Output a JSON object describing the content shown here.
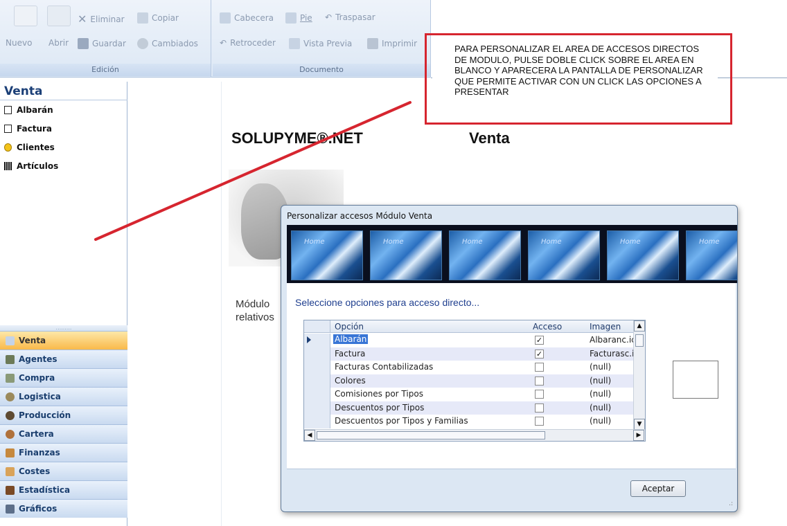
{
  "ribbon": {
    "edicion": {
      "label": "Edición",
      "nuevo": "Nuevo",
      "abrir": "Abrir",
      "eliminar": "Eliminar",
      "copiar": "Copiar",
      "guardar": "Guardar",
      "cambiados": "Cambiados"
    },
    "documento": {
      "label": "Documento",
      "cabecera": "Cabecera",
      "pie": "Pie",
      "traspasar": "Traspasar",
      "retroceder": "Retroceder",
      "vista_previa": "Vista Previa",
      "imprimir": "Imprimir"
    }
  },
  "callout": {
    "text": "PARA PERSONALIZAR EL AREA DE ACCESOS DIRECTOS DE MODULO, PULSE DOBLE CLICK SOBRE EL AREA EN BLANCO Y APARECERA LA PANTALLA DE PERSONALIZAR QUE PERMITE ACTIVAR CON UN CLICK LAS OPCIONES A PRESENTAR",
    "border_color": "#d6252f"
  },
  "nav": {
    "title": "Venta",
    "shortcuts": [
      {
        "label": "Albarán",
        "icon": "document-icon"
      },
      {
        "label": "Factura",
        "icon": "invoice-icon"
      },
      {
        "label": "Clientes",
        "icon": "smiley-icon"
      },
      {
        "label": "Artículos",
        "icon": "barcode-icon"
      }
    ],
    "modules": [
      {
        "label": "Venta",
        "active": true
      },
      {
        "label": "Agentes"
      },
      {
        "label": "Compra"
      },
      {
        "label": "Logistica"
      },
      {
        "label": "Producción"
      },
      {
        "label": "Cartera"
      },
      {
        "label": "Finanzas"
      },
      {
        "label": "Costes"
      },
      {
        "label": "Estadística"
      },
      {
        "label": "Gráficos"
      }
    ]
  },
  "main": {
    "brand": "SOLUPYME®.NET",
    "module_title": "Venta",
    "desc_line1": "Módulo",
    "desc_line2": "relativos"
  },
  "dialog": {
    "title": "Personalizar accesos Módulo Venta",
    "banner_text": "Home",
    "prompt": "Seleccione opciones para acceso directo...",
    "columns": [
      "Opción",
      "Acceso",
      "Imagen"
    ],
    "rows": [
      {
        "opcion": "Albarán",
        "acceso": true,
        "imagen": "Albaranc.ico"
      },
      {
        "opcion": "Factura",
        "acceso": true,
        "imagen": "Facturasc.ico"
      },
      {
        "opcion": "Facturas Contabilizadas",
        "acceso": false,
        "imagen": "(null)"
      },
      {
        "opcion": "Colores",
        "acceso": false,
        "imagen": "(null)"
      },
      {
        "opcion": "Comisiones por Tipos",
        "acceso": false,
        "imagen": "(null)"
      },
      {
        "opcion": "Descuentos por Tipos",
        "acceso": false,
        "imagen": "(null)"
      },
      {
        "opcion": "Descuentos por Tipos y Familias",
        "acceso": false,
        "imagen": "(null)"
      }
    ],
    "accept": "Aceptar"
  }
}
